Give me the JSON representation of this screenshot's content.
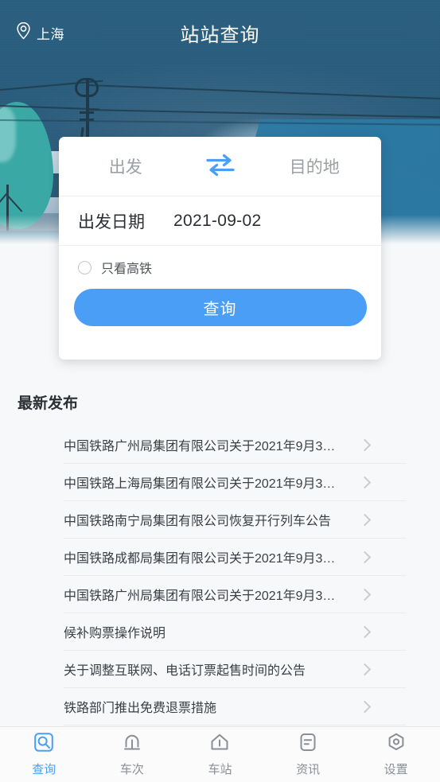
{
  "topbar": {
    "city": "上海",
    "city_icon": "location-pin-icon",
    "title": "站站查询"
  },
  "search_card": {
    "from_placeholder": "出发",
    "to_placeholder": "目的地",
    "swap_icon": "swap-horizontal-icon",
    "date_label": "出发日期",
    "date_value": "2021-09-02",
    "option_label": "只看高铁",
    "option_checked": false,
    "submit_label": "查询",
    "accent_color": "#4a9ef6"
  },
  "news": {
    "section_title": "最新发布",
    "chevron_icon": "chevron-right-icon",
    "items": [
      {
        "text": "中国铁路广州局集团有限公司关于2021年9月3…"
      },
      {
        "text": "中国铁路上海局集团有限公司关于2021年9月3…"
      },
      {
        "text": "中国铁路南宁局集团有限公司恢复开行列车公告"
      },
      {
        "text": "中国铁路成都局集团有限公司关于2021年9月3…"
      },
      {
        "text": "中国铁路广州局集团有限公司关于2021年9月3…"
      },
      {
        "text": "候补购票操作说明"
      },
      {
        "text": "关于调整互联网、电话订票起售时间的公告"
      },
      {
        "text": "铁路部门推出免费退票措施"
      }
    ]
  },
  "bottom_nav": {
    "active_color": "#4a9ef6",
    "inactive_color": "#8a8f95",
    "items": [
      {
        "label": "查询",
        "icon": "search-square-icon",
        "active": true
      },
      {
        "label": "车次",
        "icon": "train-pantograph-icon",
        "active": false
      },
      {
        "label": "车站",
        "icon": "station-home-icon",
        "active": false
      },
      {
        "label": "资讯",
        "icon": "news-document-icon",
        "active": false
      },
      {
        "label": "设置",
        "icon": "settings-hex-icon",
        "active": false
      }
    ]
  },
  "theme": {
    "header_bg": "#2a5c7c",
    "page_bg": "#f7f8f9"
  }
}
